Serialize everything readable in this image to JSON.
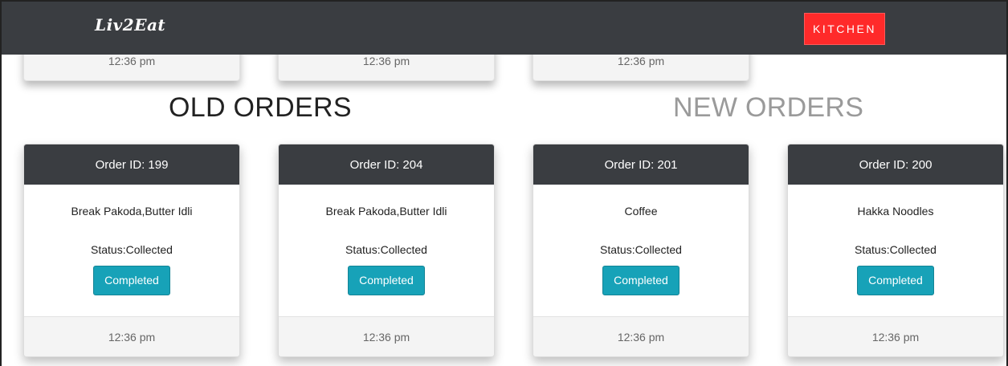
{
  "header": {
    "brand": "Liv2Eat",
    "kitchen_label": "KITCHEN",
    "kitchen_color": "#ff2a2a",
    "bg_color": "#3a3d41"
  },
  "top_cards": [
    {
      "time": "12:36 pm"
    },
    {
      "time": "12:36 pm"
    },
    {
      "time": "12:36 pm"
    }
  ],
  "sections": {
    "old_title": "OLD ORDERS",
    "new_title": "NEW ORDERS"
  },
  "orders": [
    {
      "header": "Order ID: 199",
      "items": "Break Pakoda,Butter Idli",
      "status": "Status:Collected",
      "button": "Completed",
      "time": "12:36 pm"
    },
    {
      "header": "Order ID: 204",
      "items": "Break Pakoda,Butter Idli",
      "status": "Status:Collected",
      "button": "Completed",
      "time": "12:36 pm"
    },
    {
      "header": "Order ID: 201",
      "items": "Coffee",
      "status": "Status:Collected",
      "button": "Completed",
      "time": "12:36 pm"
    },
    {
      "header": "Order ID: 200",
      "items": "Hakka Noodles",
      "status": "Status:Collected",
      "button": "Completed",
      "time": "12:36 pm"
    }
  ],
  "colors": {
    "button_bg": "#17a2b8",
    "card_header_bg": "#3a3d41"
  }
}
